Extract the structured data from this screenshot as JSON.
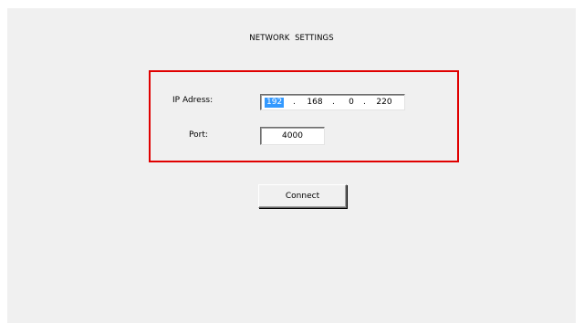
{
  "title": "NETWORK  SETTINGS",
  "ip_label": "IP Adress:",
  "ip_octets": [
    "192",
    "168",
    "0",
    "220"
  ],
  "ip_separator": ".",
  "port_label": "Port:",
  "port_value": "4000",
  "connect_label": "Connect",
  "colors": {
    "group_border": "#e00000",
    "selection": "#3399ff",
    "window_bg": "#f0f0f0"
  }
}
